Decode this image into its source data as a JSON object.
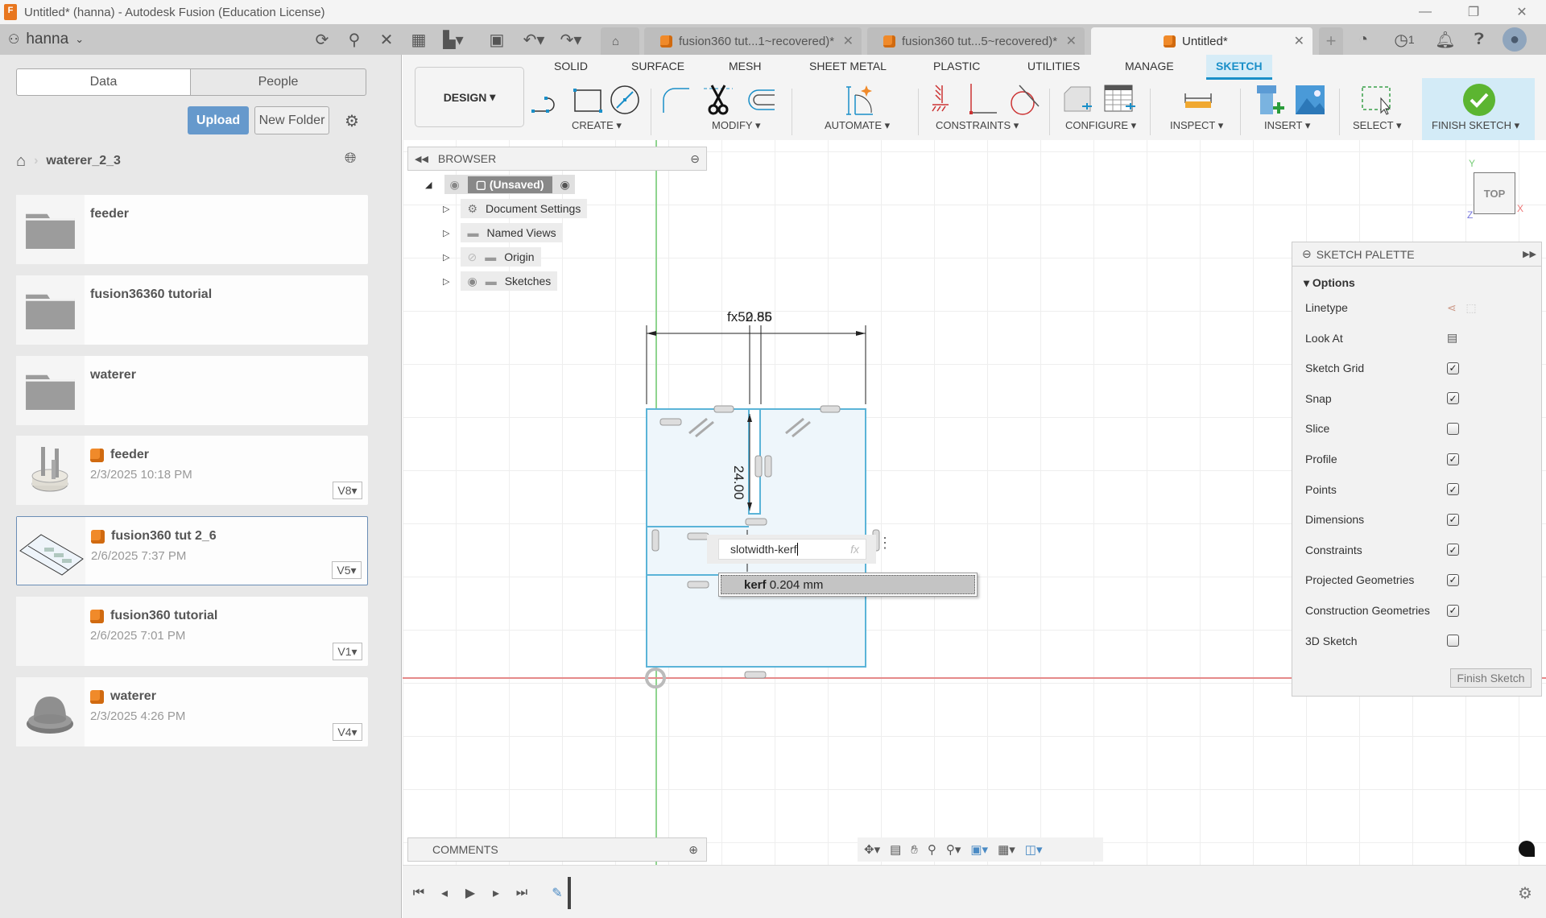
{
  "window": {
    "title": "Untitled* (hanna) - Autodesk Fusion (Education License)",
    "app_icon_letter": "F",
    "controls": [
      "minimize",
      "restore",
      "close"
    ]
  },
  "topbar": {
    "user": "hanna",
    "icons": [
      "refresh-icon",
      "search-icon",
      "close-icon",
      "apps-grid-icon",
      "file-icon",
      "save-icon",
      "undo-icon",
      "redo-icon",
      "home-icon"
    ],
    "tabs": [
      {
        "label": "fusion360 tut...1~recovered)*",
        "active": false
      },
      {
        "label": "fusion360 tut...5~recovered)*",
        "active": false
      },
      {
        "label": "Untitled*",
        "active": true
      }
    ],
    "job_count": "1"
  },
  "datapanel": {
    "tabs": [
      "Data",
      "People"
    ],
    "upload_label": "Upload",
    "new_folder_label": "New Folder",
    "breadcrumb": "waterer_2_3",
    "folders": [
      {
        "name": "feeder"
      },
      {
        "name": "fusion36360 tutorial"
      },
      {
        "name": "waterer"
      }
    ],
    "files": [
      {
        "name": "feeder",
        "date": "2/3/2025 10:18 PM",
        "version": "V8",
        "selected": false
      },
      {
        "name": "fusion360 tut 2_6",
        "date": "2/6/2025 7:37 PM",
        "version": "V5",
        "selected": true
      },
      {
        "name": "fusion360 tutorial",
        "date": "2/6/2025 7:01 PM",
        "version": "V1",
        "selected": false
      },
      {
        "name": "waterer",
        "date": "2/3/2025 4:26 PM",
        "version": "V4",
        "selected": false
      }
    ]
  },
  "ribbon": {
    "workspace": "DESIGN",
    "tabs": [
      "SOLID",
      "SURFACE",
      "MESH",
      "SHEET METAL",
      "PLASTIC",
      "UTILITIES",
      "MANAGE",
      "SKETCH"
    ],
    "active_tab": "SKETCH",
    "groups": [
      "CREATE",
      "MODIFY",
      "AUTOMATE",
      "CONSTRAINTS",
      "CONFIGURE",
      "INSPECT",
      "INSERT",
      "SELECT",
      "FINISH SKETCH"
    ]
  },
  "browser": {
    "title": "BROWSER",
    "root": "(Unsaved)",
    "items": [
      "Document Settings",
      "Named Views",
      "Origin",
      "Sketches"
    ]
  },
  "sketch": {
    "dim_top_overlap": "fx52.85",
    "dim_top_overlap2": "0.56",
    "dim_vertical": "24.00",
    "edit_value": "slotwidth-kerf",
    "fx_label": "fx",
    "suggestion_name": "kerf",
    "suggestion_value": "0.204 mm"
  },
  "viewcube": {
    "face": "TOP",
    "axes": {
      "x": "X",
      "y": "Y",
      "z": "Z"
    }
  },
  "palette": {
    "title": "SKETCH PALETTE",
    "section": "Options",
    "rows": [
      {
        "label": "Linetype",
        "type": "icons"
      },
      {
        "label": "Look At",
        "type": "icon"
      },
      {
        "label": "Sketch Grid",
        "checked": true
      },
      {
        "label": "Snap",
        "checked": true
      },
      {
        "label": "Slice",
        "checked": false
      },
      {
        "label": "Profile",
        "checked": true
      },
      {
        "label": "Points",
        "checked": true
      },
      {
        "label": "Dimensions",
        "checked": true
      },
      {
        "label": "Constraints",
        "checked": true
      },
      {
        "label": "Projected Geometries",
        "checked": true
      },
      {
        "label": "Construction Geometries",
        "checked": true
      },
      {
        "label": "3D Sketch",
        "checked": false
      }
    ],
    "finish_label": "Finish Sketch"
  },
  "comments": {
    "title": "COMMENTS"
  },
  "colors": {
    "accent": "#1a8fc8",
    "upload": "#6699cc",
    "finish_green": "#5cb531",
    "sketch_fill": "#eef6fb",
    "sketch_line": "#5bb4d8"
  }
}
